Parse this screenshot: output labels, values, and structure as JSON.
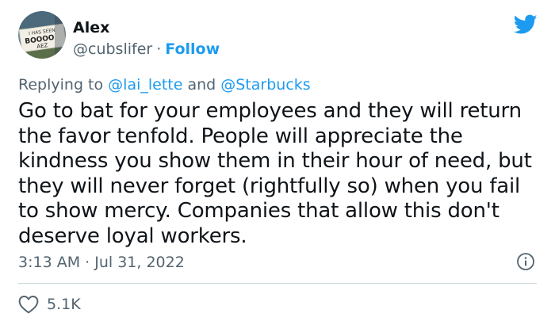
{
  "author": {
    "name": "Alex",
    "handle": "@cubslifer",
    "separator": "·",
    "follow_label": "Follow",
    "avatar_sign_text": [
      "I HAS SEEN",
      "BOOOO",
      "AEZ"
    ]
  },
  "brand": {
    "icon": "twitter-bird-icon",
    "color": "#1d9bf0"
  },
  "replying": {
    "prefix": "Replying to",
    "mention_1": "@lai_lette",
    "conjunction": "and",
    "mention_2": "@Starbucks"
  },
  "tweet": {
    "lines": [
      "Go to bat for your employees and they will return",
      "the favor tenfold. People will appreciate the",
      "kindness you show them in their hour of need, but",
      "they will never forget (rightfully so) when you fail",
      "to show mercy. Companies that allow this don't",
      "deserve loyal workers."
    ]
  },
  "meta": {
    "time": "3:13 AM",
    "separator": "·",
    "date": "Jul 31, 2022",
    "info_icon": "info-icon"
  },
  "engagement": {
    "like_icon": "heart-icon",
    "likes": "5.1K"
  }
}
